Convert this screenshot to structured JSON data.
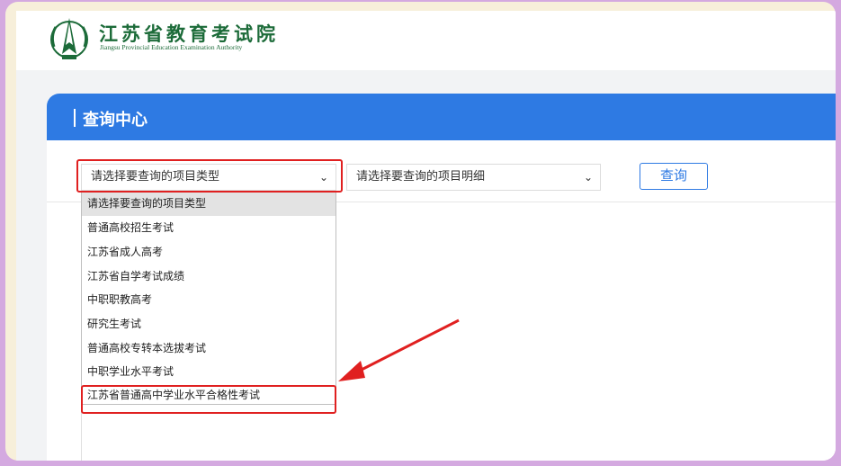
{
  "header": {
    "logo_icon": "emblem-icon",
    "org_name_cn": "江苏省教育考试院",
    "org_name_en": "Jiangsu Provincial Education Examination Authority"
  },
  "query_center": {
    "title": "查询中心",
    "type_select": {
      "value": "请选择要查询的项目类型"
    },
    "detail_select": {
      "value": "请选择要查询的项目明细"
    },
    "query_button": "查询"
  },
  "dropdown": {
    "options": [
      "请选择要查询的项目类型",
      "普通高校招生考试",
      "江苏省成人高考",
      "江苏省自学考试成绩",
      "中职职教高考",
      "研究生考试",
      "普通高校专转本选拔考试",
      "中职学业水平考试",
      "江苏省普通高中学业水平合格性考试"
    ],
    "highlighted_index": 0
  },
  "annotations": {
    "highlight_color": "#e02020"
  },
  "colors": {
    "brand_green": "#1c6b39",
    "header_blue": "#2e7ae3",
    "frame_purple": "#d4a9e0",
    "frame_cream": "#f7efda"
  }
}
